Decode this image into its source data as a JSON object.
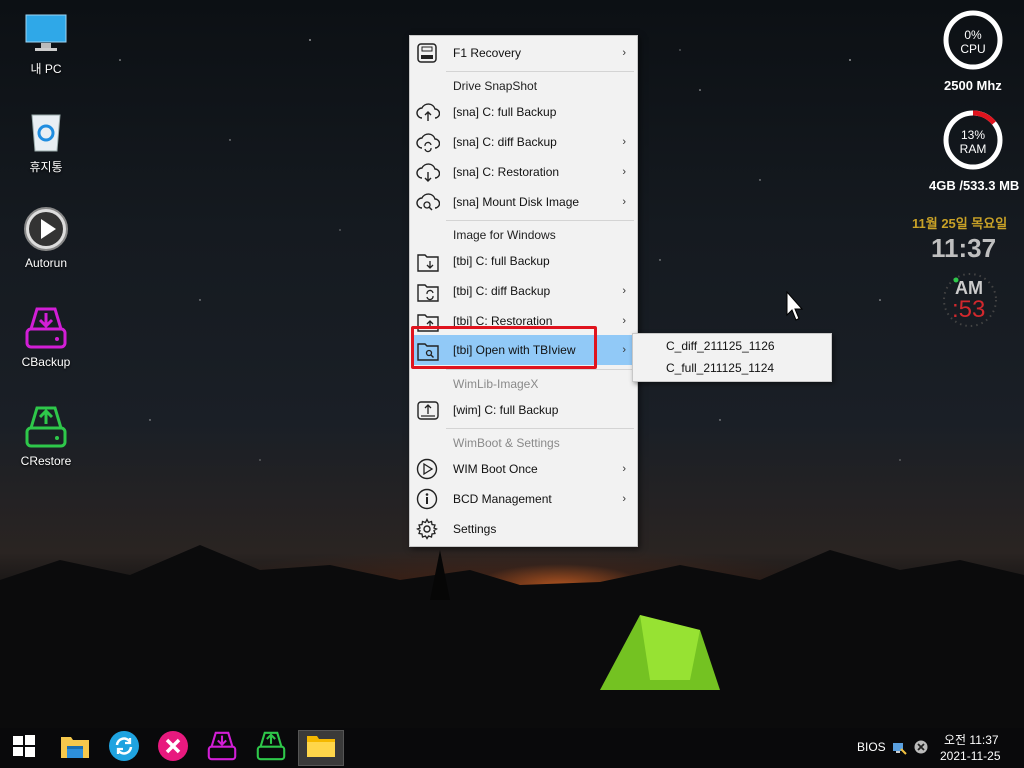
{
  "desktop": {
    "icons": [
      {
        "label": "내 PC",
        "icon": "monitor-icon"
      },
      {
        "label": "휴지통",
        "icon": "recycle-bin-icon"
      },
      {
        "label": "Autorun",
        "icon": "play-icon"
      },
      {
        "label": "CBackup",
        "icon": "backup-drive-icon"
      },
      {
        "label": "CRestore",
        "icon": "restore-drive-icon"
      }
    ]
  },
  "menu": {
    "items": [
      {
        "label": "F1 Recovery",
        "icon": "drive-icon",
        "has_submenu": true
      },
      {
        "header": "Drive SnapShot"
      },
      {
        "label": "[sna] C: full Backup",
        "icon": "cloud-up-icon",
        "has_submenu": false
      },
      {
        "label": "[sna] C: diff Backup",
        "icon": "cloud-sync-icon",
        "has_submenu": true
      },
      {
        "label": "[sna] C: Restoration",
        "icon": "cloud-down-icon",
        "has_submenu": true
      },
      {
        "label": "[sna] Mount Disk Image",
        "icon": "cloud-search-icon",
        "has_submenu": true
      },
      {
        "header": "Image for Windows"
      },
      {
        "label": "[tbi] C: full Backup",
        "icon": "folder-down-icon",
        "has_submenu": false
      },
      {
        "label": "[tbi] C: diff Backup",
        "icon": "folder-sync-icon",
        "has_submenu": true
      },
      {
        "label": "[tbi] C: Restoration",
        "icon": "folder-restore-icon",
        "has_submenu": true
      },
      {
        "label": "[tbi] Open with TBIview",
        "icon": "folder-search-icon",
        "has_submenu": true,
        "selected": true
      },
      {
        "header": "WimLib-ImageX"
      },
      {
        "label": "[wim] C: full Backup",
        "icon": "drive-up-icon",
        "has_submenu": false
      },
      {
        "header": "WimBoot & Settings"
      },
      {
        "label": "WIM Boot Once",
        "icon": "play-circle-icon",
        "has_submenu": true
      },
      {
        "label": "BCD Management",
        "icon": "info-icon",
        "has_submenu": true
      },
      {
        "label": "Settings",
        "icon": "gear-icon",
        "has_submenu": false
      }
    ],
    "arrow": "›"
  },
  "submenu": {
    "items": [
      "C_diff_211125_1126",
      "C_full_211125_1124"
    ]
  },
  "widgets": {
    "cpu": {
      "percent_label": "0%",
      "name": "CPU",
      "value": 0,
      "freq": "2500 Mhz"
    },
    "ram": {
      "percent_label": "13%",
      "name": "RAM",
      "value": 13,
      "usage": "4GB /533.3 MB"
    },
    "date": "11월 25일 목요일",
    "time": "11:37",
    "ampm": "AM",
    "seconds": ":53"
  },
  "taskbar": {
    "apps": [
      "start-icon",
      "explorer-icon",
      "refresh-icon",
      "close-app-icon",
      "cbackup-icon",
      "crestore-icon",
      "folder-icon"
    ],
    "tray_bios": "BIOS",
    "tray_time": "오전 11:37",
    "tray_date": "2021-11-25"
  },
  "colors": {
    "accent_selected": "#91c9f7",
    "highlight_box": "#e0141e",
    "date_gold": "#c9a227",
    "seconds_red": "#d2282d",
    "cbackup": "#d21ed6",
    "crestore": "#2ec84a"
  }
}
